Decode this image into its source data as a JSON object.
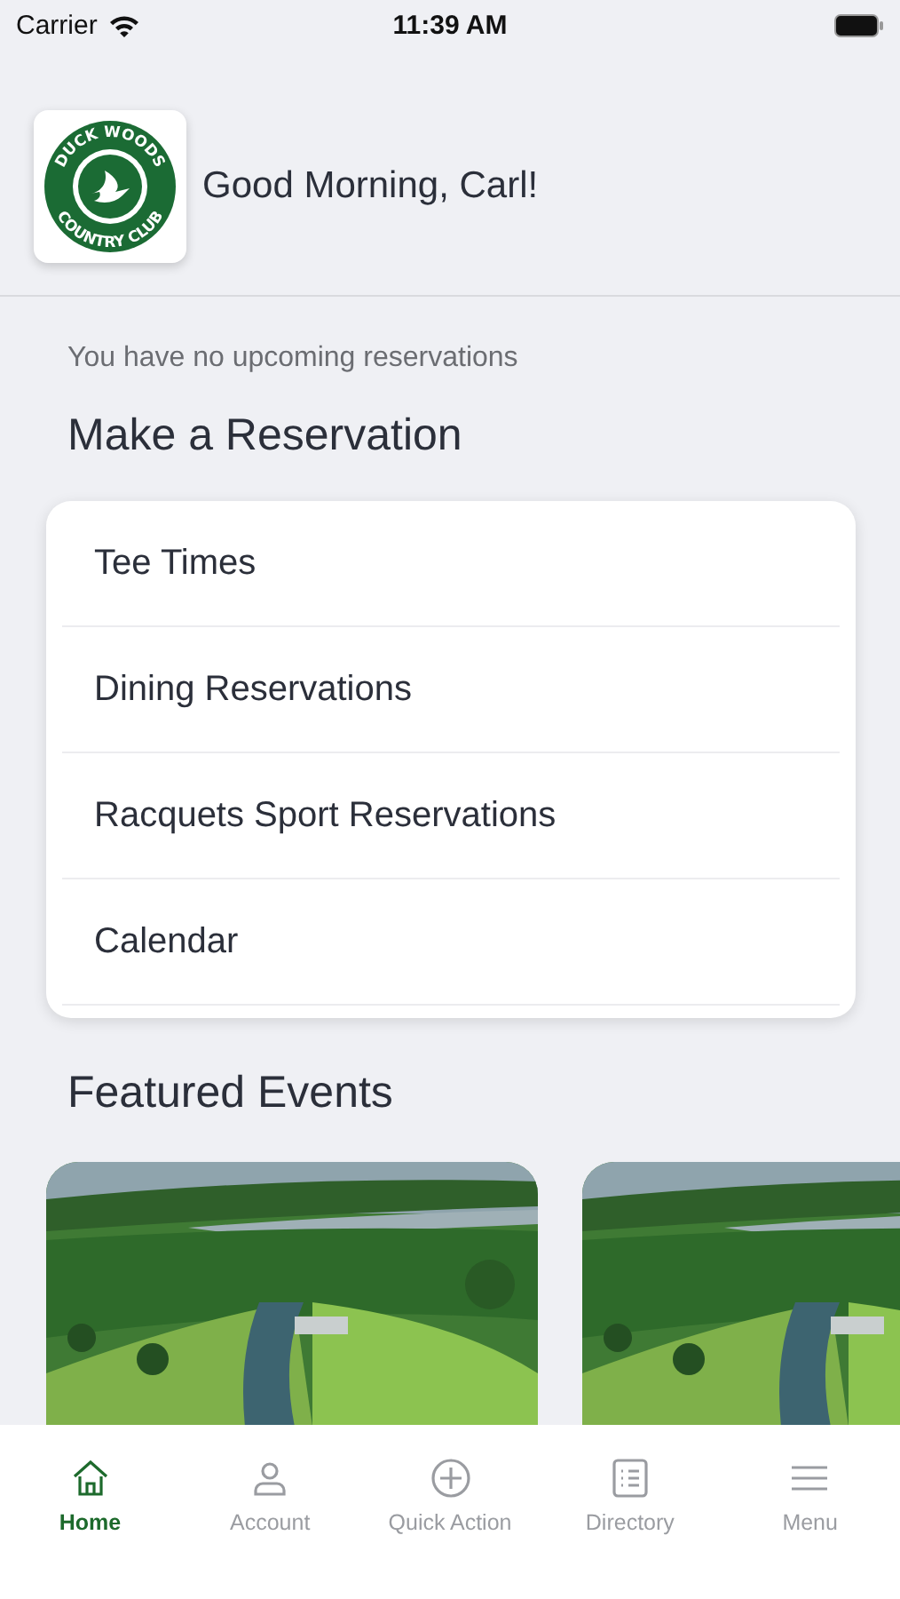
{
  "status_bar": {
    "carrier": "Carrier",
    "time": "11:39 AM"
  },
  "header": {
    "logo": {
      "top": "DUCK WOODS",
      "bottom": "COUNTRY CLUB"
    },
    "greeting": "Good Morning, Carl!"
  },
  "notice": "You have no upcoming reservations",
  "reservations": {
    "title": "Make a Reservation",
    "items": [
      {
        "label": "Tee Times"
      },
      {
        "label": "Dining Reservations"
      },
      {
        "label": "Racquets Sport Reservations"
      },
      {
        "label": "Calendar"
      }
    ]
  },
  "featured_events": {
    "title": "Featured Events"
  },
  "tab_bar": [
    {
      "label": "Home",
      "kind": "home",
      "selected": true
    },
    {
      "label": "Account",
      "kind": "person",
      "selected": false
    },
    {
      "label": "Quick Action",
      "kind": "plus",
      "selected": false
    },
    {
      "label": "Directory",
      "kind": "list",
      "selected": false
    },
    {
      "label": "Menu",
      "kind": "menu",
      "selected": false
    }
  ]
}
